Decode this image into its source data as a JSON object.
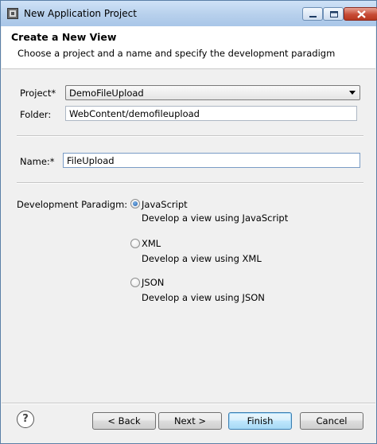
{
  "window": {
    "title": "New Application Project"
  },
  "banner": {
    "title": "Create a New View",
    "description": "Choose a project and a name and specify the development paradigm"
  },
  "form": {
    "project_label": "Project*",
    "project_value": "DemoFileUpload",
    "folder_label": "Folder:",
    "folder_value": "WebContent/demofileupload",
    "name_label": "Name:*",
    "name_value": "FileUpload"
  },
  "paradigm": {
    "label": "Development Paradigm:",
    "selected": "JavaScript",
    "options": [
      {
        "label": "JavaScript",
        "description": "Develop a view using JavaScript",
        "checked": true
      },
      {
        "label": "XML",
        "description": "Develop a view using XML",
        "checked": false
      },
      {
        "label": "JSON",
        "description": "Develop a view using JSON",
        "checked": false
      }
    ]
  },
  "footer": {
    "help": "?",
    "back": "< Back",
    "next": "Next >",
    "finish": "Finish",
    "cancel": "Cancel"
  },
  "icons": [
    "app-icon",
    "minimize-icon",
    "maximize-icon",
    "close-icon",
    "dropdown-arrow-icon",
    "help-icon"
  ],
  "colors": {
    "title_bar": "#b7d0ec",
    "close_button": "#c74c36",
    "radio_selected": "#1f5fae",
    "default_button_border": "#3c7fb1"
  }
}
